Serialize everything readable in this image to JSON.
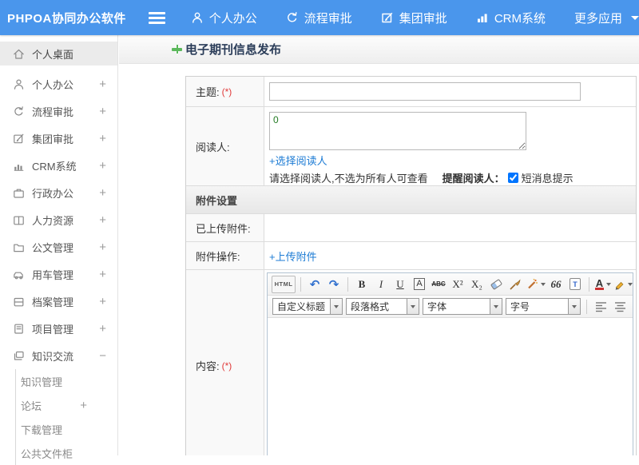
{
  "colors": {
    "topbar_blue": "#4a96ec",
    "link_blue": "#1c7bd4",
    "required_red": "#e03a3a",
    "title_navy": "#2b3d59",
    "reader_count_green": "#227a22"
  },
  "topbar": {
    "logo": "PHPOA协同办公软件",
    "nav": [
      {
        "label": "个人办公",
        "icon": "person-icon"
      },
      {
        "label": "流程审批",
        "icon": "cycle-icon"
      },
      {
        "label": "集团审批",
        "icon": "edit-icon"
      },
      {
        "label": "CRM系统",
        "icon": "bar-chart-icon"
      },
      {
        "label": "更多应用",
        "icon": "caret-down-icon"
      }
    ]
  },
  "sidebar": {
    "items": [
      {
        "label": "个人桌面",
        "icon": "home-icon",
        "expand": "",
        "active": true
      },
      {
        "label": "个人办公",
        "icon": "person-icon",
        "expand": "+"
      },
      {
        "label": "流程审批",
        "icon": "cycle-icon",
        "expand": "+"
      },
      {
        "label": "集团审批",
        "icon": "edit-icon",
        "expand": "+"
      },
      {
        "label": "CRM系统",
        "icon": "bar-chart-icon",
        "expand": "+"
      },
      {
        "label": "行政办公",
        "icon": "briefcase-icon",
        "expand": "+"
      },
      {
        "label": "人力资源",
        "icon": "book-icon",
        "expand": "+"
      },
      {
        "label": "公文管理",
        "icon": "folder-icon",
        "expand": "+"
      },
      {
        "label": "用车管理",
        "icon": "car-icon",
        "expand": "+"
      },
      {
        "label": "档案管理",
        "icon": "archive-icon",
        "expand": "+"
      },
      {
        "label": "项目管理",
        "icon": "notebook-icon",
        "expand": "+"
      },
      {
        "label": "知识交流",
        "icon": "layers-icon",
        "expand": "−",
        "expanded": true
      }
    ],
    "subitems": [
      {
        "label": "知识管理",
        "expand": ""
      },
      {
        "label": "论坛",
        "expand": "+"
      },
      {
        "label": "下载管理",
        "expand": ""
      },
      {
        "label": "公共文件柜",
        "expand": ""
      }
    ]
  },
  "page": {
    "title": "电子期刊信息发布"
  },
  "form": {
    "subject": {
      "label": "主题:",
      "required": "(*)",
      "value": ""
    },
    "readers": {
      "label": "阅读人:",
      "count": "0",
      "select_link": "+选择阅读人",
      "hint": "请选择阅读人,不选为所有人可查看",
      "remind_label": "提醒阅读人：",
      "sms_option": "短消息提示",
      "sms_checked": "checked"
    },
    "attachments": {
      "section_title": "附件设置",
      "uploaded_label": "已上传附件:",
      "ops_label": "附件操作:",
      "upload_link": "+上传附件"
    },
    "content": {
      "label": "内容:",
      "required": "(*)"
    }
  },
  "editor": {
    "source_button": "HTML",
    "undo_glyph": "↶",
    "redo_glyph": "↷",
    "bold_glyph": "B",
    "italic_glyph": "I",
    "underline_glyph": "U",
    "font_box_glyph": "A",
    "strike_glyph": "ABC",
    "superscript_glyph": "X²",
    "subscript_glyph": "X₂",
    "quote_glyph": "66",
    "paste_text_glyph": "T",
    "forecolor_glyph": "A",
    "selects": [
      {
        "value": "自定义标题"
      },
      {
        "value": "段落格式"
      },
      {
        "value": "字体"
      },
      {
        "value": "字号"
      }
    ]
  }
}
